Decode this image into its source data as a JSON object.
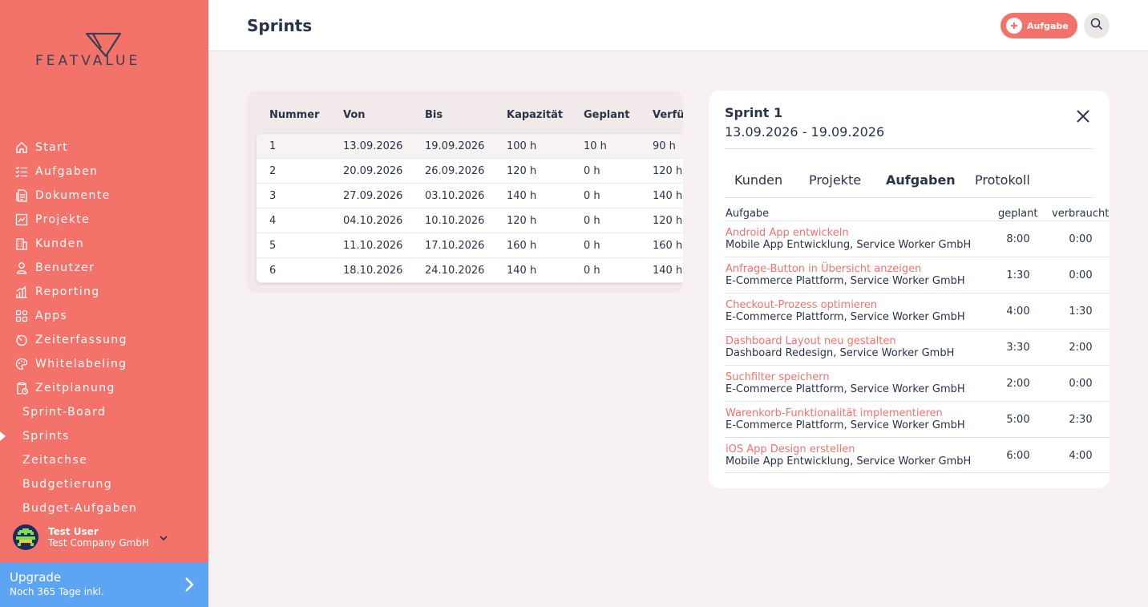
{
  "brand": {
    "name": "FEATVALUE",
    "accent": "#f3736b",
    "upgrade_color": "#5da5f3"
  },
  "sidebar": {
    "items": [
      {
        "label": "Start",
        "icon": "home-icon"
      },
      {
        "label": "Aufgaben",
        "icon": "checklist-icon"
      },
      {
        "label": "Dokumente",
        "icon": "document-icon"
      },
      {
        "label": "Projekte",
        "icon": "chart-icon"
      },
      {
        "label": "Kunden",
        "icon": "building-icon"
      },
      {
        "label": "Benutzer",
        "icon": "user-icon"
      },
      {
        "label": "Reporting",
        "icon": "bar-chart-icon"
      },
      {
        "label": "Apps",
        "icon": "apps-grid-icon"
      },
      {
        "label": "Zeiterfassung",
        "icon": "stopwatch-icon"
      },
      {
        "label": "Whitelabeling",
        "icon": "palette-icon"
      },
      {
        "label": "Zeitplanung",
        "icon": "clipboard-clock-icon"
      }
    ],
    "sub_items": [
      {
        "label": "Sprint-Board"
      },
      {
        "label": "Sprints",
        "active": true
      },
      {
        "label": "Zeitachse"
      },
      {
        "label": "Budgetierung"
      },
      {
        "label": "Budget-Aufgaben"
      }
    ],
    "user": {
      "name": "Test User",
      "company": "Test Company GmbH"
    },
    "upgrade": {
      "title": "Upgrade",
      "subtitle": "Noch 365 Tage inkl."
    }
  },
  "header": {
    "title": "Sprints",
    "add_label": "Aufgabe"
  },
  "sprints_table": {
    "columns": [
      "Nummer",
      "Von",
      "Bis",
      "Kapazität",
      "Geplant",
      "Verfü"
    ],
    "rows": [
      [
        "1",
        "13.09.2026",
        "19.09.2026",
        "100 h",
        "10 h",
        "90 h"
      ],
      [
        "2",
        "20.09.2026",
        "26.09.2026",
        "120 h",
        "0 h",
        "120 h"
      ],
      [
        "3",
        "27.09.2026",
        "03.10.2026",
        "140 h",
        "0 h",
        "140 h"
      ],
      [
        "4",
        "04.10.2026",
        "10.10.2026",
        "120 h",
        "0 h",
        "120 h"
      ],
      [
        "5",
        "11.10.2026",
        "17.10.2026",
        "160 h",
        "0 h",
        "160 h"
      ],
      [
        "6",
        "18.10.2026",
        "24.10.2026",
        "140 h",
        "0 h",
        "140 h"
      ]
    ]
  },
  "detail": {
    "title": "Sprint 1",
    "range": "13.09.2026 - 19.09.2026",
    "tabs": [
      "Kunden",
      "Projekte",
      "Aufgaben",
      "Protokoll"
    ],
    "active_tab": "Aufgaben",
    "task_columns": [
      "Aufgabe",
      "geplant",
      "verbraucht"
    ],
    "tasks": [
      {
        "title": "Android App entwickeln",
        "sub": "Mobile App Entwicklung, Service Worker GmbH",
        "planned": "8:00",
        "used": "0:00"
      },
      {
        "title": "Anfrage-Button in Übersicht anzeigen",
        "sub": "E-Commerce Plattform, Service Worker GmbH",
        "planned": "1:30",
        "used": "0:00"
      },
      {
        "title": "Checkout-Prozess optimieren",
        "sub": "E-Commerce Plattform, Service Worker GmbH",
        "planned": "4:00",
        "used": "1:30"
      },
      {
        "title": "Dashboard Layout neu gestalten",
        "sub": "Dashboard Redesign, Service Worker GmbH",
        "planned": "3:30",
        "used": "2:00"
      },
      {
        "title": "Suchfilter speichern",
        "sub": "E-Commerce Plattform, Service Worker GmbH",
        "planned": "2:00",
        "used": "0:00"
      },
      {
        "title": "Warenkorb-Funktionalität implementieren",
        "sub": "E-Commerce Plattform, Service Worker GmbH",
        "planned": "5:00",
        "used": "2:30"
      },
      {
        "title": "iOS App Design erstellen",
        "sub": "Mobile App Entwicklung, Service Worker GmbH",
        "planned": "6:00",
        "used": "4:00"
      }
    ]
  }
}
